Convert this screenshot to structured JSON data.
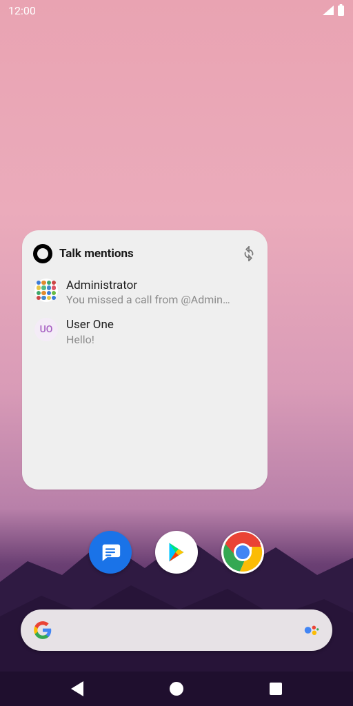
{
  "statusbar": {
    "time": "12:00"
  },
  "widget": {
    "title": "Talk mentions",
    "mentions": [
      {
        "avatar_initials": "",
        "name": "Administrator",
        "message": "You missed a call from @Admin…"
      },
      {
        "avatar_initials": "UO",
        "name": "User One",
        "message": "Hello!"
      }
    ]
  }
}
